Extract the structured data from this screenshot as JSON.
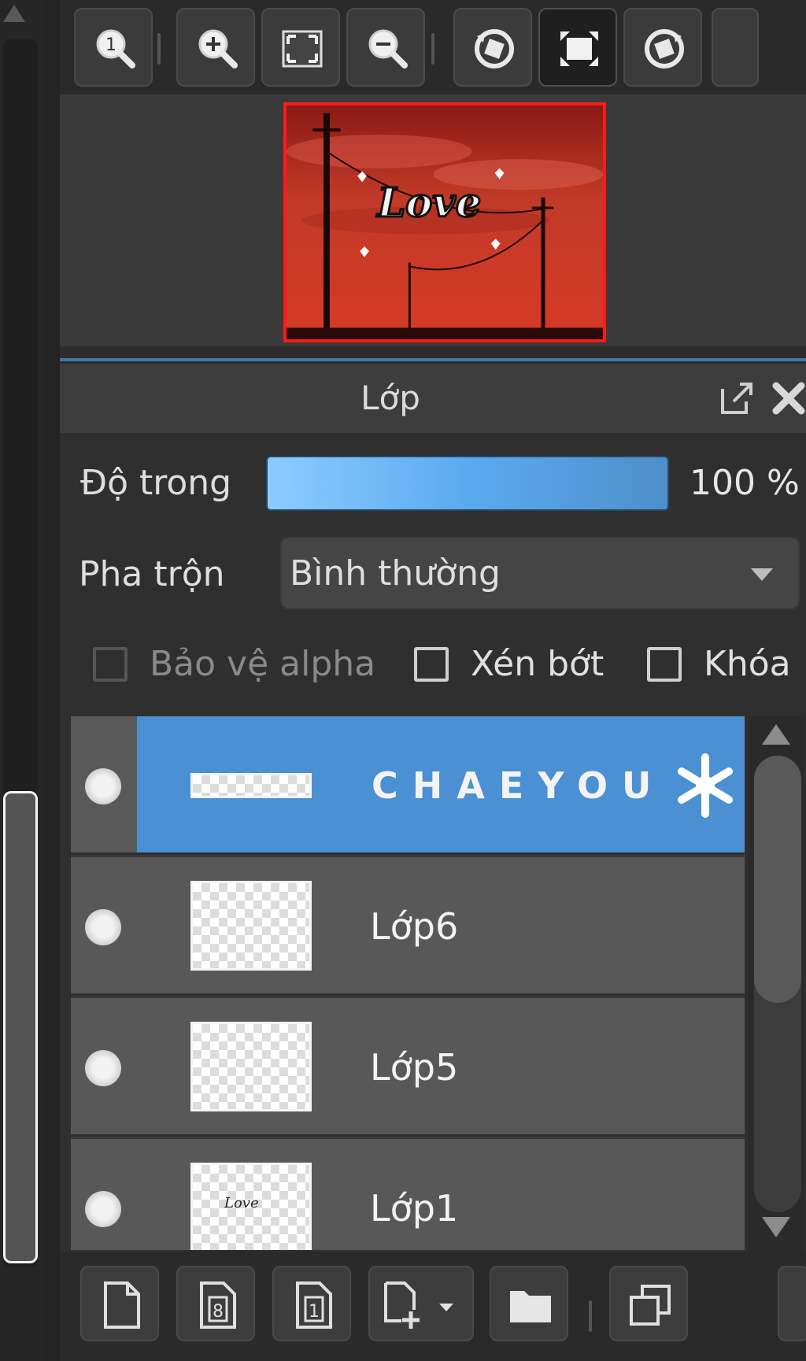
{
  "toolbar": {
    "buttons": [
      "actual-size",
      "zoom-in",
      "fit-to-window",
      "zoom-out",
      "rotate-left",
      "fullscreen",
      "rotate-right"
    ]
  },
  "navigator": {
    "preview_text": "Love"
  },
  "panel": {
    "title": "Lớp"
  },
  "opacity": {
    "label": "Độ trong",
    "value": "100 %",
    "level_percent": 100
  },
  "blend": {
    "label": "Pha trộn",
    "selected": "Bình thường"
  },
  "options": {
    "protect_alpha": "Bảo vệ alpha",
    "clip": "Xén bớt",
    "lock": "Khóa"
  },
  "layers": [
    {
      "name": "CHAEYOU",
      "selected": true
    },
    {
      "name": "Lớp6",
      "selected": false
    },
    {
      "name": "Lớp5",
      "selected": false
    },
    {
      "name": "Lớp1",
      "selected": false,
      "thumb_text": "Love"
    }
  ],
  "colors": {
    "accent": "#4a90d2",
    "opacity_bar": "#6ab4f5",
    "preview_border": "#ff1a1a"
  }
}
